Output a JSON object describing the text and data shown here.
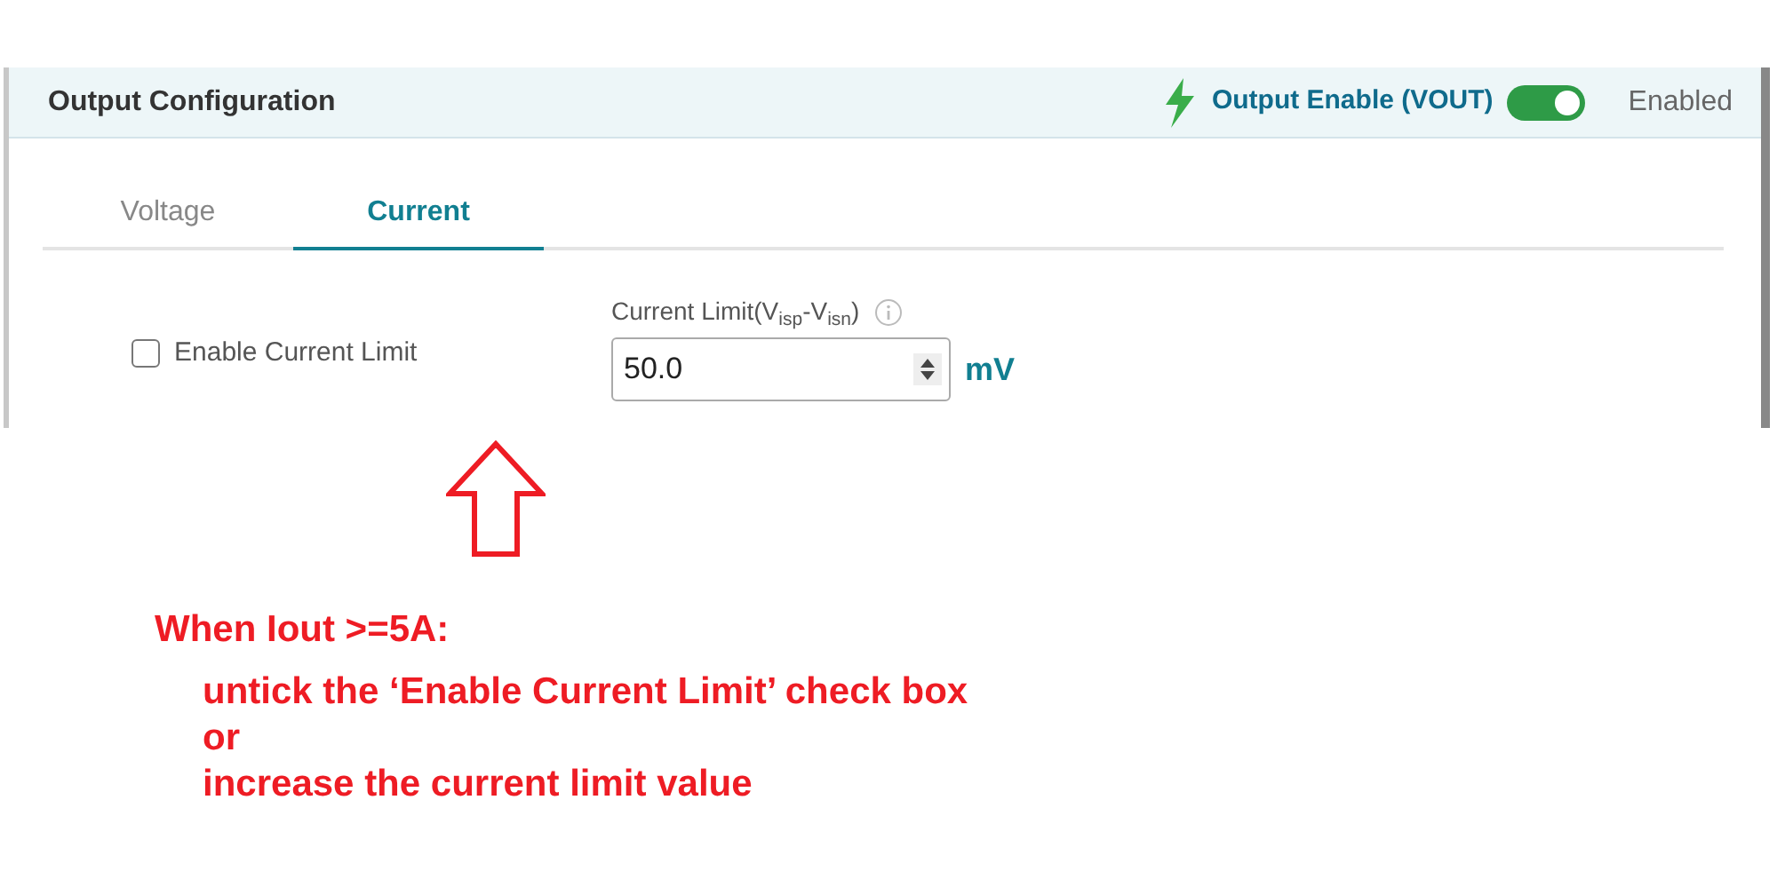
{
  "panel": {
    "title": "Output Configuration",
    "output_enable": {
      "label": "Output Enable (VOUT)",
      "on": true,
      "status": "Enabled"
    },
    "tabs": [
      {
        "label": "Voltage",
        "selected": false
      },
      {
        "label": "Current",
        "selected": true
      }
    ],
    "enable_current_limit": {
      "label": "Enable Current Limit",
      "checked": false
    },
    "current_limit": {
      "label": "Current Limit(V$_{isp}$-V$_{isn}$)",
      "value": "50.0",
      "unit": "mV"
    }
  },
  "annotation": {
    "heading": "When Iout >=5A:",
    "lines": [
      "untick the ‘Enable Current Limit’ check box",
      "or",
      "increase the current limit value"
    ]
  }
}
